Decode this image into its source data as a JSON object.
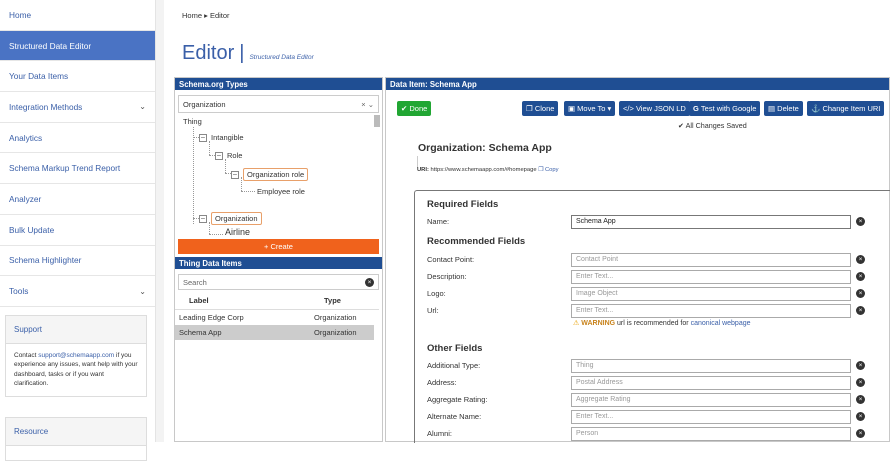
{
  "sidebar": {
    "items": [
      {
        "label": "Home",
        "active": false
      },
      {
        "label": "Structured Data Editor",
        "active": true
      },
      {
        "label": "Your Data Items",
        "active": false
      },
      {
        "label": "Integration Methods",
        "active": false,
        "chevron": true
      },
      {
        "label": "Analytics",
        "active": false
      },
      {
        "label": "Schema Markup Trend Report",
        "active": false
      },
      {
        "label": "Analyzer",
        "active": false
      },
      {
        "label": "Bulk Update",
        "active": false
      },
      {
        "label": "Schema Highlighter",
        "active": false
      },
      {
        "label": "Tools",
        "active": false,
        "chevron": true
      }
    ],
    "support": {
      "title": "Support",
      "text_before": "Contact ",
      "email": "support@schemaapp.com",
      "text_after": " if you experience any issues, want help with your dashboard, tasks or if you want clarification."
    },
    "resource": {
      "title": "Resource"
    }
  },
  "main": {
    "breadcrumb": "Home ▸ Editor",
    "title": "Editor",
    "subtitle": "Structured Data Editor"
  },
  "schema_types": {
    "header": "Schema.org Types",
    "selected_type": "Organization",
    "tree": {
      "thing": "Thing",
      "intangible": "Intangible",
      "role": "Role",
      "organization_role": "Organization role",
      "employee_role": "Employee role",
      "organization": "Organization",
      "airline": "Airline"
    },
    "create_label": "+ Create"
  },
  "thing_items": {
    "header": "Thing Data Items",
    "search_placeholder": "Search",
    "columns": [
      "Label",
      "Type"
    ],
    "rows": [
      {
        "label": "Leading Edge Corp",
        "type": "Organization",
        "selected": false
      },
      {
        "label": "Schema App",
        "type": "Organization",
        "selected": true
      }
    ]
  },
  "data_item": {
    "header": "Data Item: Schema App",
    "buttons": {
      "done": "Done",
      "clone": "Clone",
      "move_to": "Move To",
      "view_json": "View JSON LD",
      "test_google": "Test with Google",
      "delete": "Delete",
      "change_uri": "Change Item URI"
    },
    "status": "All Changes Saved",
    "org_title": "Organization:  Schema App",
    "uri_label": "URI:",
    "uri_value": "https://www.schemaapp.com/#homepage",
    "copy_label": "Copy",
    "required_title": "Required Fields",
    "recommended_title": "Recommended Fields",
    "other_title": "Other Fields",
    "fields": {
      "name": {
        "label": "Name:",
        "value": "Schema App"
      },
      "contact_point": {
        "label": "Contact Point:",
        "placeholder": "Contact Point"
      },
      "description": {
        "label": "Description:",
        "placeholder": "Enter Text..."
      },
      "logo": {
        "label": "Logo:",
        "placeholder": "Image Object"
      },
      "url": {
        "label": "Url:",
        "placeholder": "Enter Text..."
      },
      "additional_type": {
        "label": "Additional Type:",
        "placeholder": "Thing"
      },
      "address": {
        "label": "Address:",
        "placeholder": "Postal Address"
      },
      "aggregate_rating": {
        "label": "Aggregate Rating:",
        "placeholder": "Aggregate Rating"
      },
      "alternate_name": {
        "label": "Alternate Name:",
        "placeholder": "Enter Text..."
      },
      "alumni": {
        "label": "Alumni:",
        "placeholder": "Person"
      }
    },
    "warning": {
      "label": "WARNING",
      "text": " url is recommended for ",
      "link": "canonical webpage"
    }
  },
  "colors": {
    "accent": "#1f4e93",
    "sidebar_active": "#4a73c4",
    "create": "#f0621c",
    "done": "#21a633",
    "warning": "#e8a000"
  }
}
